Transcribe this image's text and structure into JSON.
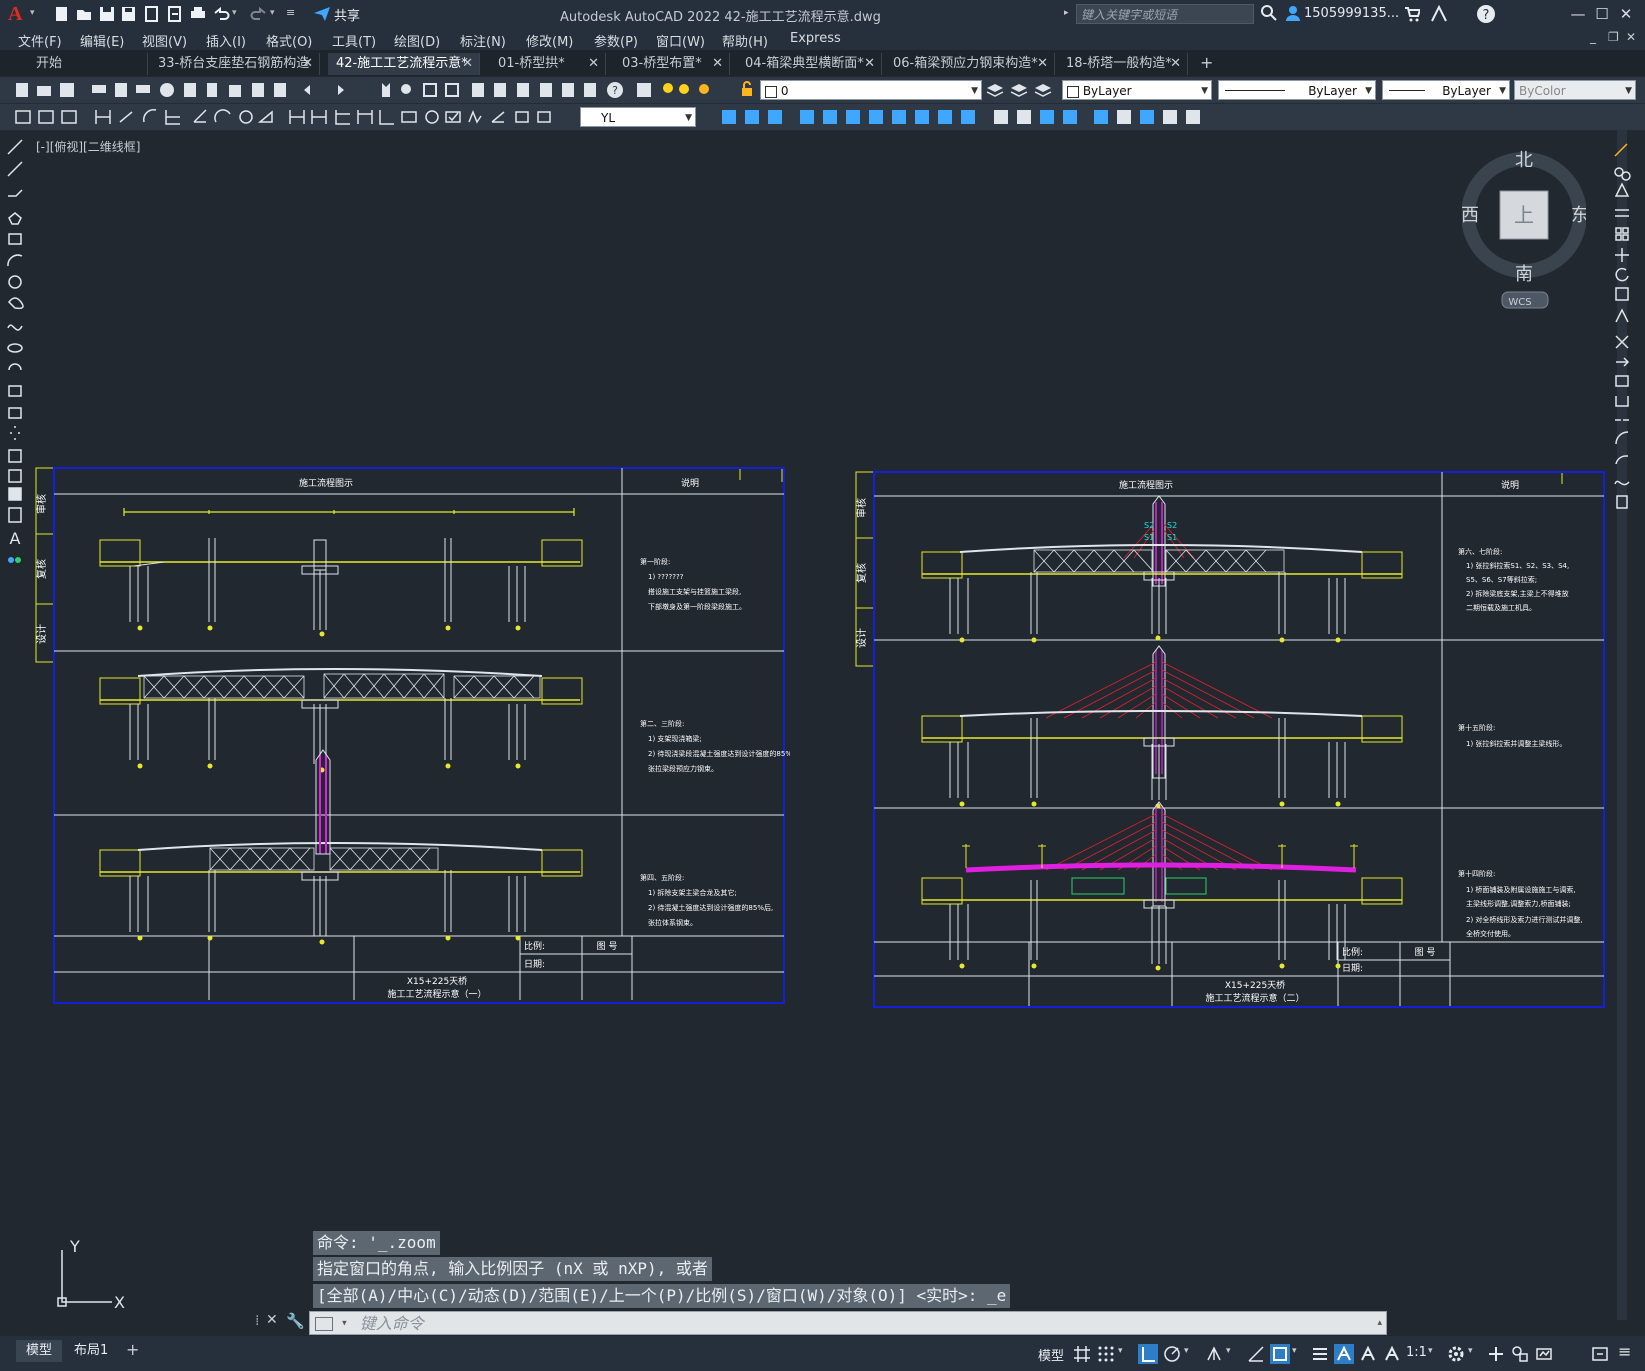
{
  "titlebar": {
    "logo": "A",
    "share_label": "共享",
    "app_title": "Autodesk AutoCAD 2022    42-施工工艺流程示意.dwg",
    "search_placeholder": "键入关键字或短语",
    "user_id": "1505999135..."
  },
  "menubar": [
    "文件(F)",
    "编辑(E)",
    "视图(V)",
    "插入(I)",
    "格式(O)",
    "工具(T)",
    "绘图(D)",
    "标注(N)",
    "修改(M)",
    "参数(P)",
    "窗口(W)",
    "帮助(H)",
    "Express"
  ],
  "tabs": [
    {
      "label": "开始"
    },
    {
      "label": "33-桥台支座垫石钢筋构造"
    },
    {
      "label": "42-施工工艺流程示意*"
    },
    {
      "label": "01-桥型拱*"
    },
    {
      "label": "03-桥型布置*"
    },
    {
      "label": "04-箱梁典型横断面*"
    },
    {
      "label": "06-箱梁预应力钢束构造*"
    },
    {
      "label": "18-桥塔一般构造*"
    }
  ],
  "layer_combo": "0",
  "color_combo": "ByLayer",
  "linetype_combo": "ByLayer",
  "lineweight_combo": "ByLayer",
  "plotstyle_combo": "ByColor",
  "dimstyle_combo": "YL",
  "viewport_label": "[-][俯视][二维线框]",
  "viewcube": {
    "north": "北",
    "south": "南",
    "east": "东",
    "west": "西",
    "top": "上",
    "wcs": "WCS"
  },
  "drawing1": {
    "header_left": "施工流程图示",
    "header_right": "说明",
    "side_labels": [
      "审核",
      "复核",
      "设计"
    ],
    "notes": [
      [
        "第一阶段:",
        "1) ???????",
        "   搭设施工支架与挂篮施工梁段,",
        "   下部墩身及第一阶段梁段施工。"
      ],
      [
        "第二、三阶段:",
        "1) 支架现浇箱梁;",
        "2) 待现浇梁段混凝土强度达到设计强度的85%后,",
        "   张拉梁段预应力钢束。"
      ],
      [
        "第四、五阶段:",
        "1) 拆除支架主梁合龙及其它;",
        "2) 待混凝土强度达到设计强度的85%后,",
        "   张拉体系钢束。"
      ]
    ],
    "title_line1": "X15+225天桥",
    "title_line2": "施工工艺流程示意（一）",
    "scale_label": "比例:",
    "date_label": "日期:",
    "figno_label": "图 号"
  },
  "drawing2": {
    "header_left": "施工流程图示",
    "header_right": "说明",
    "side_labels": [
      "审核",
      "复核",
      "设计"
    ],
    "cable_labels": [
      "S2",
      "S2",
      "S1",
      "S1"
    ],
    "notes": [
      [
        "第六、七阶段:",
        "1) 张拉斜拉索S1、S2、S3、S4,",
        "   S5、S6、S7等斜拉索;",
        "2) 拆除梁底支架,主梁上不得堆放",
        "   二期恒载及施工机具。"
      ],
      [
        "第十五阶段:",
        "1) 张拉斜拉索并调整主梁线形。"
      ],
      [
        "第十四阶段:",
        "1) 桥面铺装及附属设施施工与调索,",
        "   主梁线形调整,调整索力,桥面铺装;",
        "2) 对全桥线形及索力进行测试并调整,",
        "   全桥交付使用。"
      ]
    ],
    "title_line1": "X15+225天桥",
    "title_line2": "施工工艺流程示意（二）",
    "scale_label": "比例:",
    "date_label": "日期:",
    "figno_label": "图 号"
  },
  "command": {
    "line1": "命令: '_.zoom",
    "line2": "指定窗口的角点, 输入比例因子 (nX 或 nXP), 或者",
    "line3": "[全部(A)/中心(C)/动态(D)/范围(E)/上一个(P)/比例(S)/窗口(W)/对象(O)] <实时>: _e",
    "input_placeholder": "键入命令"
  },
  "ucs": {
    "x": "X",
    "y": "Y"
  },
  "statusbar": {
    "tabs": [
      "模型",
      "布局1"
    ],
    "model_btn": "模型",
    "scale": "1:1"
  },
  "colors": {
    "frame_blue": "#1420d8",
    "yellow": "#e8e82a",
    "cable_red": "#e0202a",
    "magenta": "#e020e0",
    "cyan": "#20e0e0"
  }
}
